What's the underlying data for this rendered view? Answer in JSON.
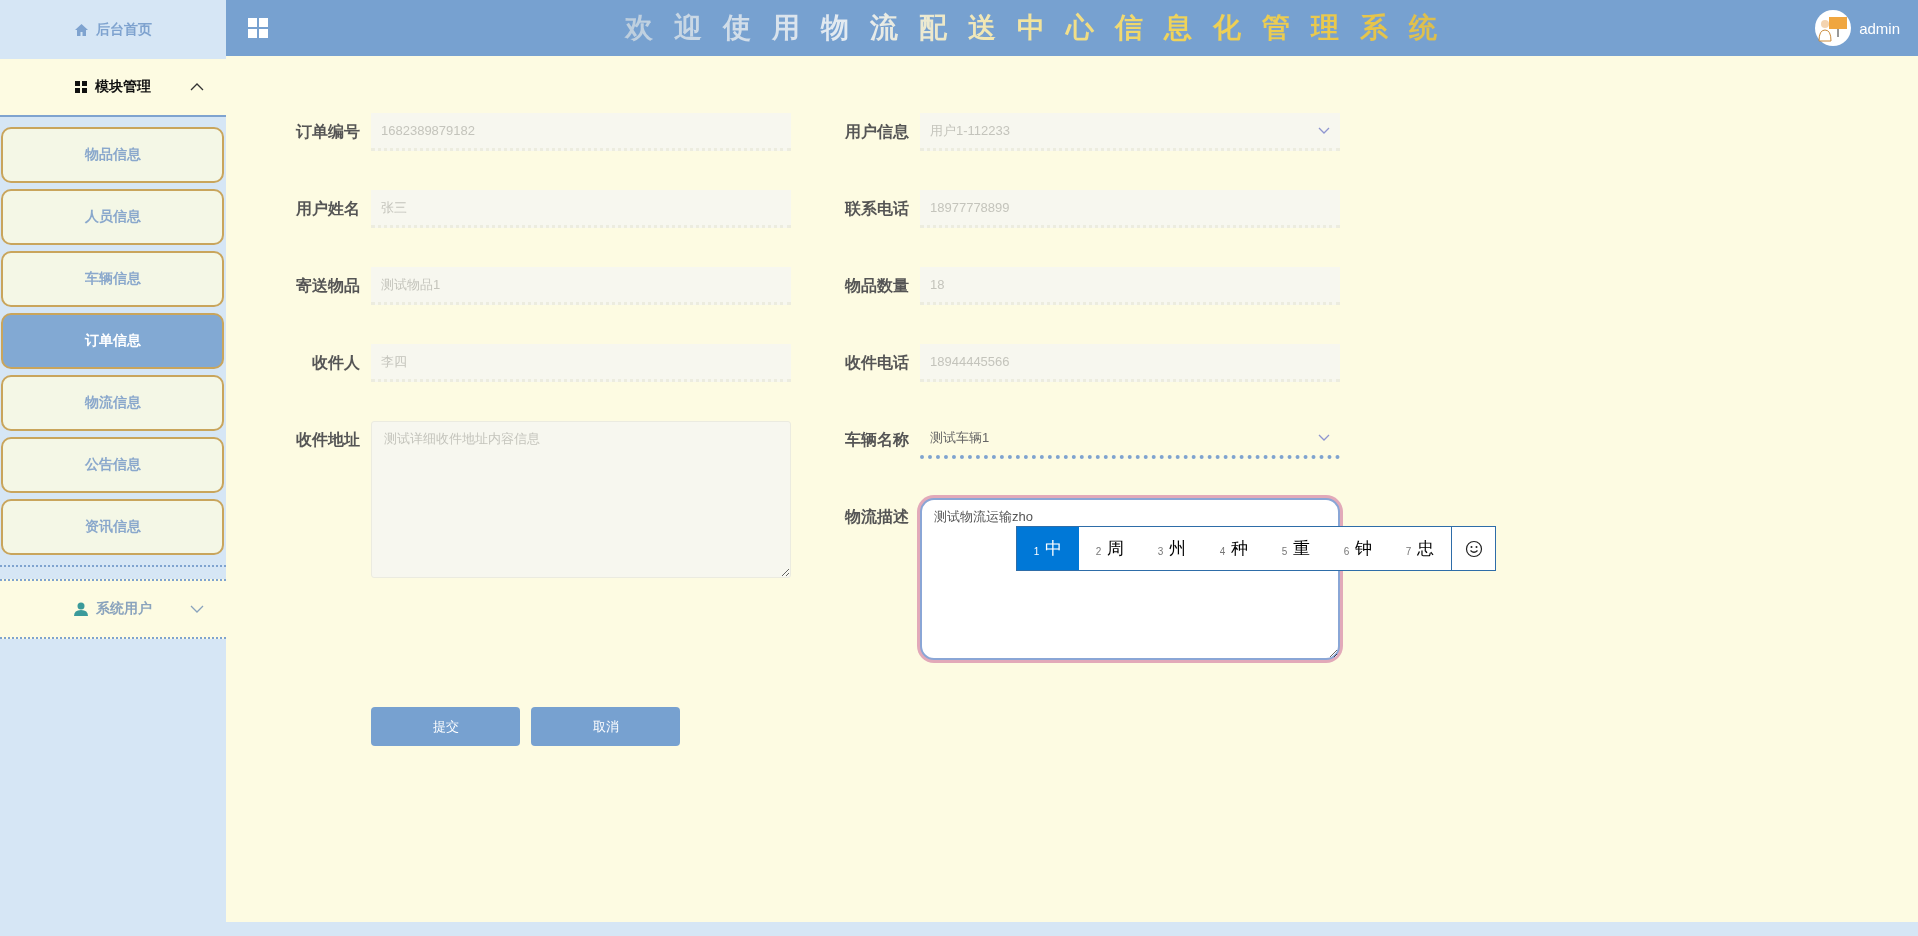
{
  "sidebar": {
    "home": {
      "label": "后台首页"
    },
    "groups": [
      {
        "label": "模块管理",
        "expanded": true,
        "items": [
          {
            "label": "物品信息",
            "selected": false
          },
          {
            "label": "人员信息",
            "selected": false
          },
          {
            "label": "车辆信息",
            "selected": false
          },
          {
            "label": "订单信息",
            "selected": true
          },
          {
            "label": "物流信息",
            "selected": false
          },
          {
            "label": "公告信息",
            "selected": false
          },
          {
            "label": "资讯信息",
            "selected": false
          }
        ]
      },
      {
        "label": "系统用户",
        "expanded": false
      }
    ]
  },
  "header": {
    "title": "欢迎使用物流配送中心信息化管理系统",
    "user": {
      "name": "admin"
    }
  },
  "form": {
    "left": [
      {
        "label": "订单编号",
        "kind": "input",
        "value": "1682389879182",
        "disabled": true
      },
      {
        "label": "用户姓名",
        "kind": "input",
        "value": "张三",
        "disabled": true
      },
      {
        "label": "寄送物品",
        "kind": "input",
        "value": "测试物品1",
        "disabled": true
      },
      {
        "label": "收件人",
        "kind": "input",
        "value": "李四",
        "disabled": true
      },
      {
        "label": "收件地址",
        "kind": "textarea",
        "value": "测试详细收件地址内容信息",
        "disabled": true,
        "focused": false
      }
    ],
    "right": [
      {
        "label": "用户信息",
        "kind": "select",
        "value": "用户1-112233",
        "disabled": true
      },
      {
        "label": "联系电话",
        "kind": "input",
        "value": "18977778899",
        "disabled": true
      },
      {
        "label": "物品数量",
        "kind": "input",
        "value": "18",
        "disabled": true
      },
      {
        "label": "收件电话",
        "kind": "input",
        "value": "18944445566",
        "disabled": true
      },
      {
        "label": "车辆名称",
        "kind": "select",
        "value": "测试车辆1",
        "disabled": false
      },
      {
        "label": "物流描述",
        "kind": "textarea",
        "value": "测试物流运输zho",
        "disabled": false,
        "focused": true
      }
    ],
    "buttons": [
      "提交",
      "取消"
    ]
  },
  "ime": {
    "candidates": [
      {
        "index": "1",
        "text": "中",
        "selected": true
      },
      {
        "index": "2",
        "text": "周",
        "selected": false
      },
      {
        "index": "3",
        "text": "州",
        "selected": false
      },
      {
        "index": "4",
        "text": "种",
        "selected": false
      },
      {
        "index": "5",
        "text": "重",
        "selected": false
      },
      {
        "index": "6",
        "text": "钟",
        "selected": false
      },
      {
        "index": "7",
        "text": "忠",
        "selected": false
      }
    ]
  }
}
